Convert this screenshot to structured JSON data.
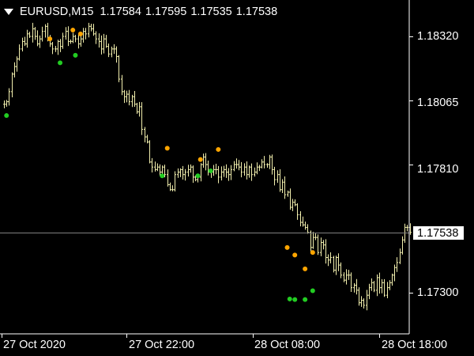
{
  "header": {
    "symbol_timeframe": "EURUSD,M15",
    "open": "1.17584",
    "high": "1.17595",
    "low": "1.17535",
    "close": "1.17538"
  },
  "current_price_label": "1.17538",
  "colors": {
    "background": "#000000",
    "candles": "#f2efae",
    "up_signal": "#ffa500",
    "down_signal": "#22cc22",
    "price_line": "#808080",
    "axes": "#ffffff"
  },
  "chart_data": {
    "type": "bar",
    "title": "",
    "xlabel": "",
    "ylabel": "",
    "ylim": [
      1.1723,
      1.1845
    ],
    "yticks": [
      "1.18320",
      "1.18065",
      "1.17810",
      "1.17300"
    ],
    "xticks": [
      "27 Oct 2020",
      "27 Oct 22:00",
      "28 Oct 08:00",
      "28 Oct 18:00"
    ],
    "current_price": 1.17538,
    "bars_close": [
      1.1805,
      1.1806,
      1.181,
      1.1817,
      1.182,
      1.1823,
      1.1827,
      1.183,
      1.1829,
      1.1833,
      1.1832,
      1.1835,
      1.1832,
      1.1829,
      1.1831,
      1.1834,
      1.1836,
      1.1831,
      1.1829,
      1.1827,
      1.1827,
      1.183,
      1.1828,
      1.1832,
      1.1834,
      1.183,
      1.183,
      1.1832,
      1.1831,
      1.1829,
      1.1831,
      1.1834,
      1.1833,
      1.1836,
      1.1835,
      1.1833,
      1.1831,
      1.183,
      1.1827,
      1.1831,
      1.1828,
      1.1825,
      1.1827,
      1.1827,
      1.1824,
      1.1815,
      1.181,
      1.1808,
      1.1809,
      1.1806,
      1.1808,
      1.1805,
      1.1802,
      1.1804,
      1.1795,
      1.1792,
      1.179,
      1.1782,
      1.178,
      1.1779,
      1.178,
      1.1778,
      1.178,
      1.1777,
      1.1773,
      1.1771,
      1.1771,
      1.1777,
      1.1778,
      1.1779,
      1.1777,
      1.1778,
      1.1779,
      1.178,
      1.1776,
      1.1775,
      1.1776,
      1.1781,
      1.1784,
      1.1781,
      1.1778,
      1.1778,
      1.1779,
      1.1779,
      1.1776,
      1.1778,
      1.1779,
      1.1778,
      1.1777,
      1.1779,
      1.1781,
      1.1781,
      1.178,
      1.1778,
      1.178,
      1.1777,
      1.178,
      1.1777,
      1.1778,
      1.178,
      1.178,
      1.1782,
      1.1781,
      1.1781,
      1.1784,
      1.1779,
      1.1775,
      1.1777,
      1.1771,
      1.1774,
      1.1769,
      1.177,
      1.1764,
      1.1766,
      1.1765,
      1.1761,
      1.1758,
      1.1757,
      1.1756,
      1.1754,
      1.1748,
      1.1752,
      1.1752,
      1.1746,
      1.175,
      1.1749,
      1.1744,
      1.1743,
      1.1744,
      1.1739,
      1.1744,
      1.1741,
      1.1737,
      1.1735,
      1.1737,
      1.1737,
      1.1732,
      1.1733,
      1.1731,
      1.1726,
      1.1727,
      1.1725,
      1.1729,
      1.1732,
      1.1734,
      1.1731,
      1.1736,
      1.1732,
      1.1734,
      1.1729,
      1.1732,
      1.1734,
      1.1737,
      1.174,
      1.1742,
      1.1746,
      1.1751,
      1.1756,
      1.1756,
      1.1754
    ],
    "up_arrows": [
      {
        "bar": 18,
        "price": 1.1831
      },
      {
        "bar": 27,
        "price": 1.18345
      },
      {
        "bar": 30,
        "price": 1.1833
      },
      {
        "bar": 64,
        "price": 1.17875
      },
      {
        "bar": 77,
        "price": 1.1783
      },
      {
        "bar": 84,
        "price": 1.1787
      },
      {
        "bar": 111,
        "price": 1.1748
      },
      {
        "bar": 114,
        "price": 1.1745
      },
      {
        "bar": 118,
        "price": 1.17395
      },
      {
        "bar": 121,
        "price": 1.1746
      }
    ],
    "down_arrows": [
      {
        "bar": 1,
        "price": 1.18005
      },
      {
        "bar": 22,
        "price": 1.18215
      },
      {
        "bar": 28,
        "price": 1.18245
      },
      {
        "bar": 62,
        "price": 1.17765
      },
      {
        "bar": 76,
        "price": 1.17765
      },
      {
        "bar": 81,
        "price": 1.17785
      },
      {
        "bar": 112,
        "price": 1.17275
      },
      {
        "bar": 114,
        "price": 1.17273
      },
      {
        "bar": 118,
        "price": 1.17273
      },
      {
        "bar": 121,
        "price": 1.17308
      }
    ]
  }
}
